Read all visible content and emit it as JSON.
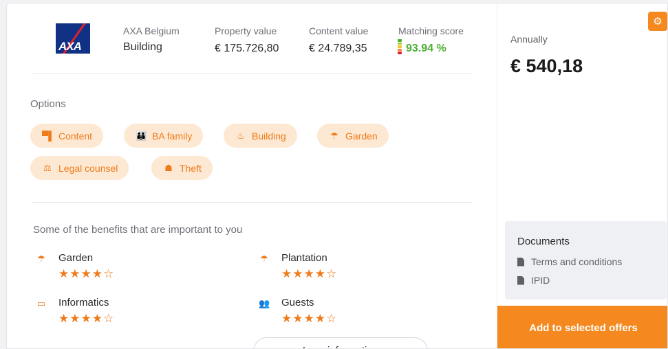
{
  "insurer": {
    "logo_text": "AXA",
    "name": "AXA Belgium",
    "product": "Building"
  },
  "header": {
    "property_value_label": "Property value",
    "property_value": "€ 175.726,80",
    "content_value_label": "Content value",
    "content_value": "€ 24.789,35",
    "matching_score_label": "Matching score",
    "matching_score": "93.94 %"
  },
  "options": {
    "title": "Options",
    "chips": [
      {
        "label": "Content",
        "icon": "furniture-icon"
      },
      {
        "label": "BA family",
        "icon": "family-icon"
      },
      {
        "label": "Building",
        "icon": "fire-icon"
      },
      {
        "label": "Garden",
        "icon": "umbrella-icon"
      },
      {
        "label": "Legal counsel",
        "icon": "scales-icon"
      },
      {
        "label": "Theft",
        "icon": "thief-icon"
      }
    ]
  },
  "benefits": {
    "title": "Some of the benefits that are important to you",
    "items": [
      {
        "label": "Garden",
        "icon": "umbrella-icon",
        "rating": 4.5
      },
      {
        "label": "Plantation",
        "icon": "umbrella-icon",
        "rating": 4.5
      },
      {
        "label": "Informatics",
        "icon": "laptop-icon",
        "rating": 4.5
      },
      {
        "label": "Guests",
        "icon": "guests-icon",
        "rating": 4.5
      }
    ],
    "more_button": "Less information"
  },
  "pricing": {
    "period": "Annually",
    "price": "€ 540,18"
  },
  "documents": {
    "title": "Documents",
    "items": [
      "Terms and conditions",
      "IPID"
    ]
  },
  "cta": {
    "label": "Add to selected offers"
  },
  "colors": {
    "accent": "#f5891f",
    "chip_bg": "#fde9d3",
    "score_green": "#4caf32",
    "brand_blue": "#103184",
    "brand_red": "#e2202d"
  }
}
